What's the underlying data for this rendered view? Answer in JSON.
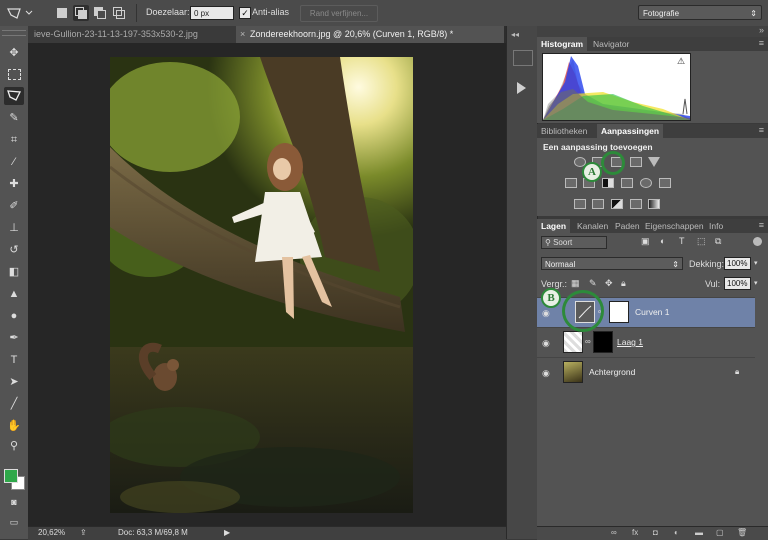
{
  "options_bar": {
    "feather_label": "Doezelaar:",
    "feather_value": "0 px",
    "antialias_label": "Anti-alias",
    "antialias_checked": true,
    "refine_edge_label": "Rand verfijnen...",
    "workspace_value": "Fotografie"
  },
  "tabs": [
    {
      "label": "ieve-Gullion-23-11-13-197-353x530-2.jpg",
      "active": false
    },
    {
      "label": "Zondereekhoorn.jpg @ 20,6% (Curven 1, RGB/8) *",
      "active": true
    }
  ],
  "status": {
    "zoom": "20,62%",
    "doc": "Doc: 63,3 M/69,8 M"
  },
  "histogram_panel": {
    "tabs": [
      "Histogram",
      "Navigator"
    ],
    "active_tab": "Histogram"
  },
  "adjustments_panel": {
    "tabs": [
      "Bibliotheken",
      "Aanpassingen"
    ],
    "active_tab": "Aanpassingen",
    "title": "Een aanpassing toevoegen"
  },
  "layers_panel": {
    "tabs": [
      "Lagen",
      "Kanalen",
      "Paden",
      "Eigenschappen",
      "Info"
    ],
    "active_tab": "Lagen",
    "filter_label": "Soort",
    "blend_mode": "Normaal",
    "opacity_label": "Dekking:",
    "opacity_value": "100%",
    "lock_label": "Vergr.:",
    "fill_label": "Vul:",
    "fill_value": "100%",
    "layers": [
      {
        "name": "Curven 1",
        "selected": true,
        "locked": false
      },
      {
        "name": "Laag 1",
        "selected": false,
        "locked": false
      },
      {
        "name": "Achtergrond",
        "selected": false,
        "locked": true
      }
    ]
  },
  "annotations": [
    {
      "label": "A"
    },
    {
      "label": "B"
    }
  ],
  "icons": {
    "adjustment_icons": [
      "brightness-icon",
      "levels-icon",
      "curves-icon",
      "exposure-icon",
      "vibrance-icon",
      "hue-saturation-icon",
      "color-balance-icon",
      "black-white-icon",
      "photo-filter-icon",
      "channel-mixer-icon",
      "color-lookup-icon",
      "invert-icon",
      "posterize-icon",
      "threshold-icon",
      "selective-color-icon",
      "gradient-map-icon"
    ]
  },
  "colors": {
    "accent_selected_layer": "#6f82a8",
    "annotation_green": "#2d8a3a",
    "foreground_color": "#2fa84a",
    "background_color": "#ffffff"
  }
}
